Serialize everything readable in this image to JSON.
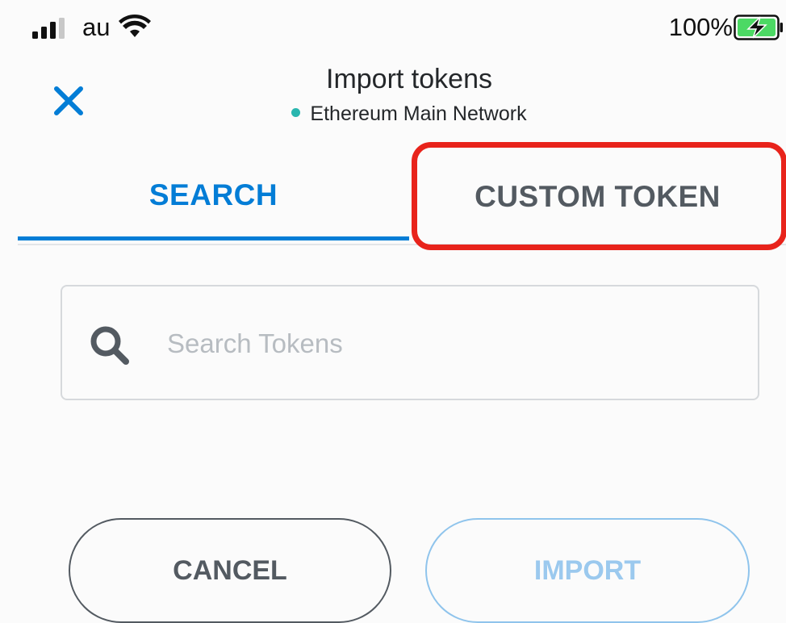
{
  "status_bar": {
    "carrier": "au",
    "battery_percent": "100%"
  },
  "header": {
    "title": "Import tokens",
    "network": "Ethereum Main Network"
  },
  "tabs": [
    {
      "label": "SEARCH",
      "active": true
    },
    {
      "label": "CUSTOM TOKEN",
      "active": false
    }
  ],
  "search": {
    "placeholder": "Search Tokens",
    "value": ""
  },
  "buttons": {
    "cancel_label": "CANCEL",
    "import_label": "IMPORT"
  },
  "colors": {
    "accent": "#037dd6",
    "network_dot": "#29b6af",
    "highlight": "#e8231b",
    "import_disabled": "#9bc9ee"
  },
  "icons": {
    "close": "close-icon",
    "search": "search-icon",
    "signal": "signal-icon",
    "wifi": "wifi-icon",
    "battery": "battery-charging-icon"
  }
}
